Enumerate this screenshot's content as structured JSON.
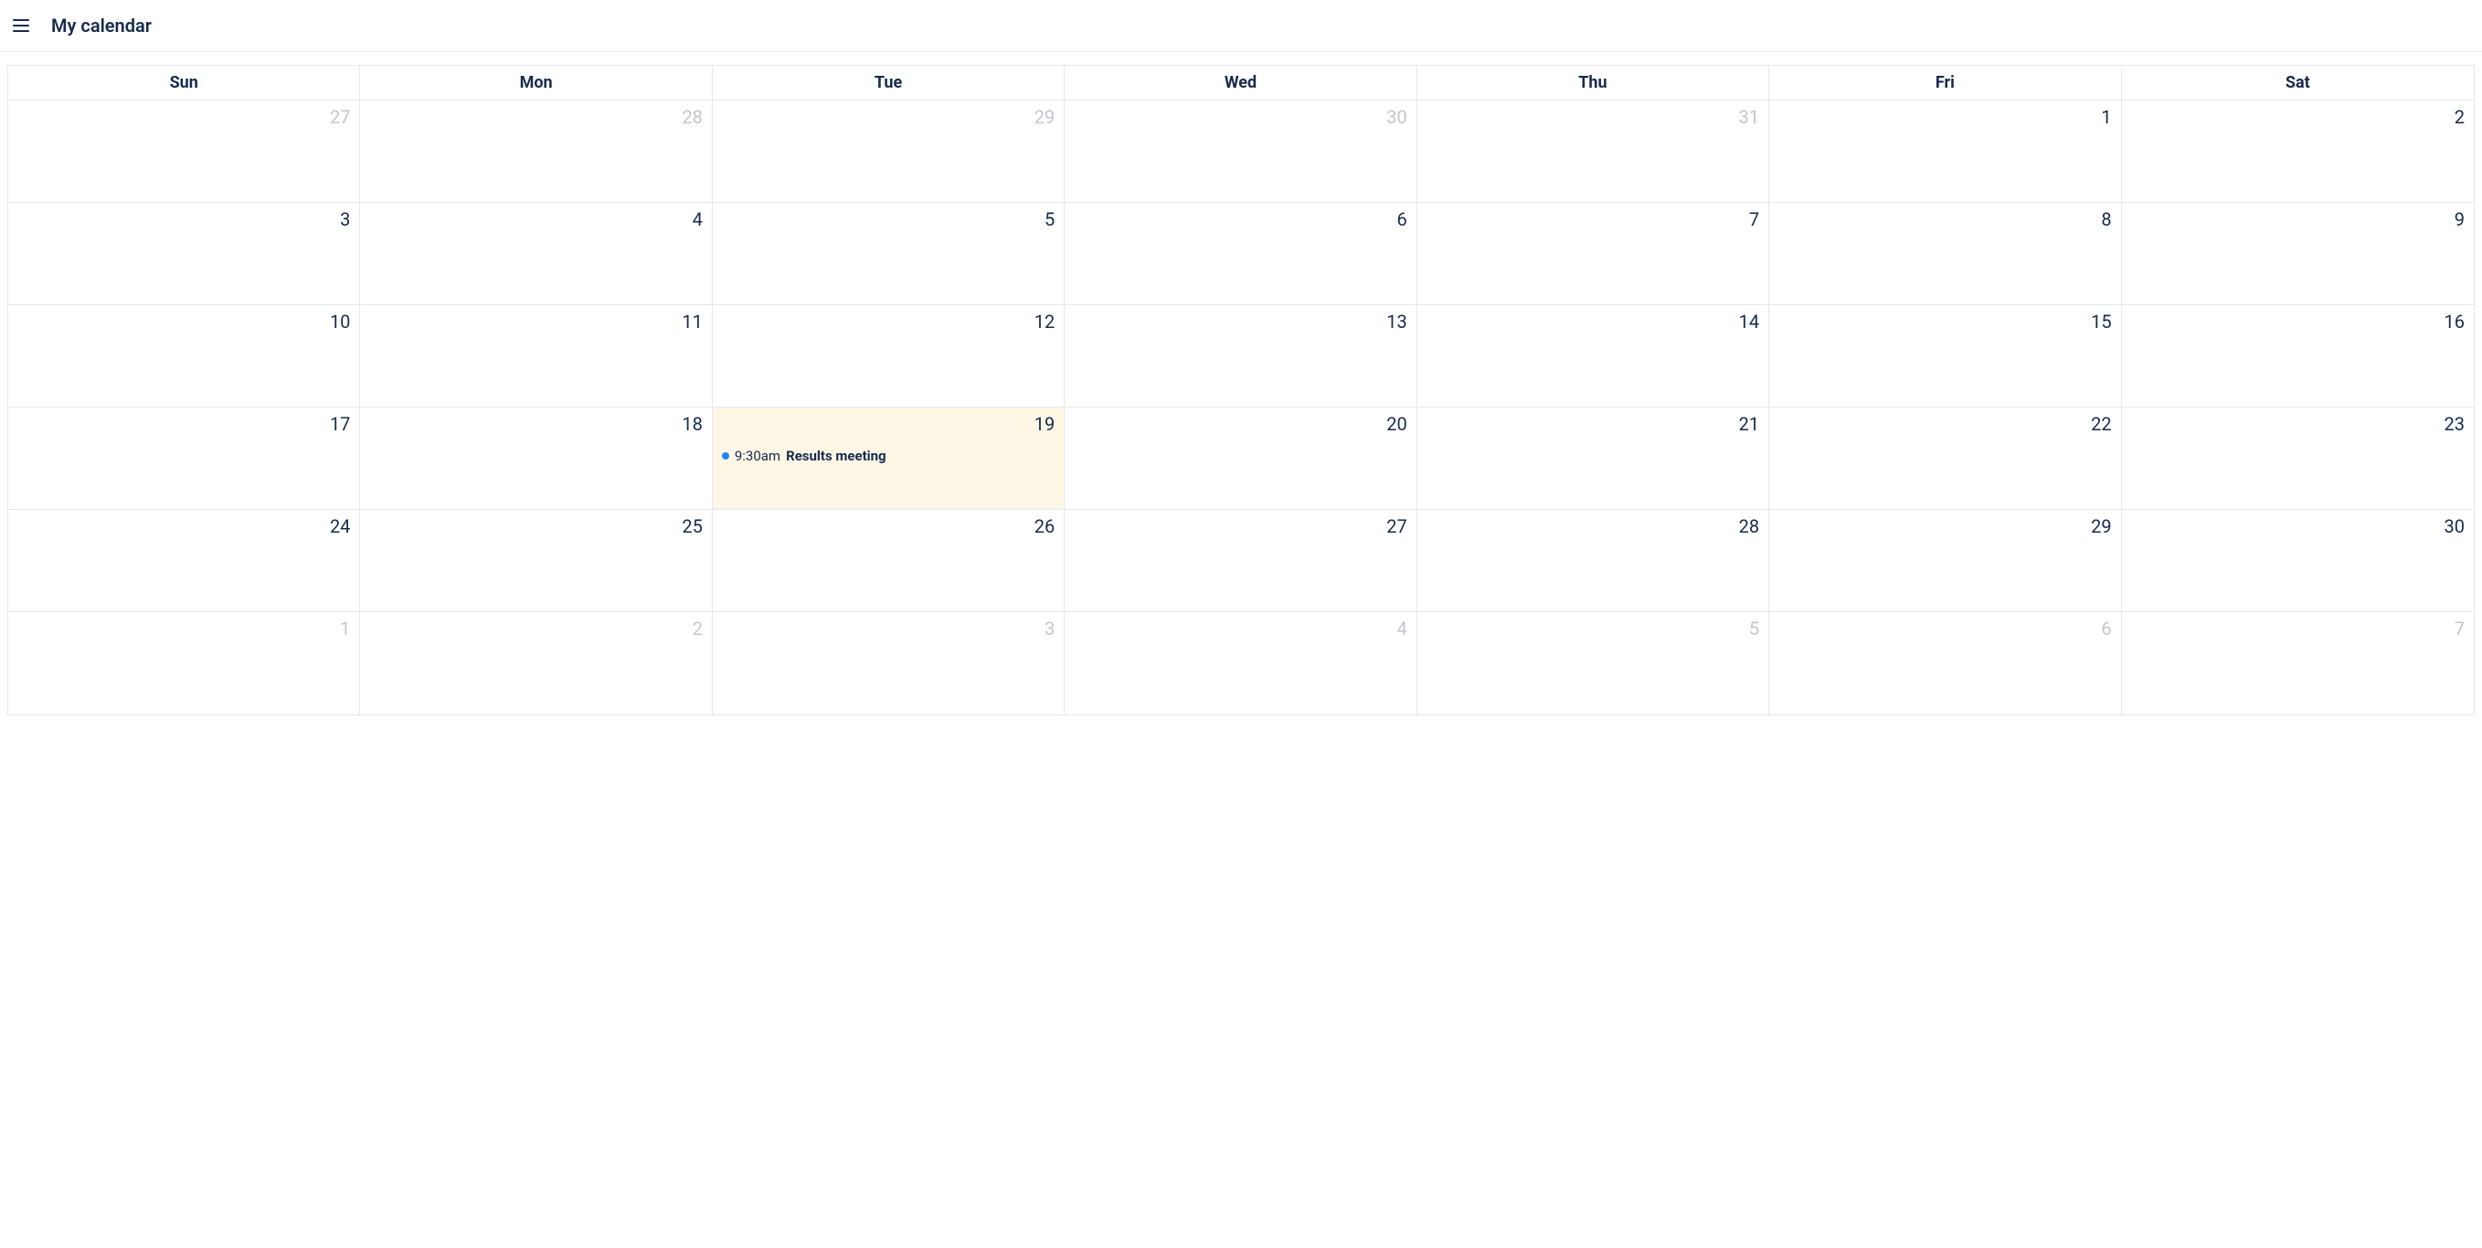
{
  "header": {
    "title": "My calendar"
  },
  "calendar": {
    "dayHeaders": [
      "Sun",
      "Mon",
      "Tue",
      "Wed",
      "Thu",
      "Fri",
      "Sat"
    ],
    "weeks": [
      [
        {
          "day": "27",
          "otherMonth": true
        },
        {
          "day": "28",
          "otherMonth": true
        },
        {
          "day": "29",
          "otherMonth": true
        },
        {
          "day": "30",
          "otherMonth": true
        },
        {
          "day": "31",
          "otherMonth": true
        },
        {
          "day": "1"
        },
        {
          "day": "2"
        }
      ],
      [
        {
          "day": "3"
        },
        {
          "day": "4"
        },
        {
          "day": "5"
        },
        {
          "day": "6"
        },
        {
          "day": "7"
        },
        {
          "day": "8"
        },
        {
          "day": "9"
        }
      ],
      [
        {
          "day": "10"
        },
        {
          "day": "11"
        },
        {
          "day": "12"
        },
        {
          "day": "13"
        },
        {
          "day": "14"
        },
        {
          "day": "15"
        },
        {
          "day": "16"
        }
      ],
      [
        {
          "day": "17"
        },
        {
          "day": "18"
        },
        {
          "day": "19",
          "today": true,
          "events": [
            {
              "time": "9:30am",
              "title": "Results meeting"
            }
          ]
        },
        {
          "day": "20"
        },
        {
          "day": "21"
        },
        {
          "day": "22"
        },
        {
          "day": "23"
        }
      ],
      [
        {
          "day": "24"
        },
        {
          "day": "25"
        },
        {
          "day": "26"
        },
        {
          "day": "27"
        },
        {
          "day": "28"
        },
        {
          "day": "29"
        },
        {
          "day": "30"
        }
      ],
      [
        {
          "day": "1",
          "otherMonth": true
        },
        {
          "day": "2",
          "otherMonth": true
        },
        {
          "day": "3",
          "otherMonth": true
        },
        {
          "day": "4",
          "otherMonth": true
        },
        {
          "day": "5",
          "otherMonth": true
        },
        {
          "day": "6",
          "otherMonth": true
        },
        {
          "day": "7",
          "otherMonth": true
        }
      ]
    ]
  }
}
